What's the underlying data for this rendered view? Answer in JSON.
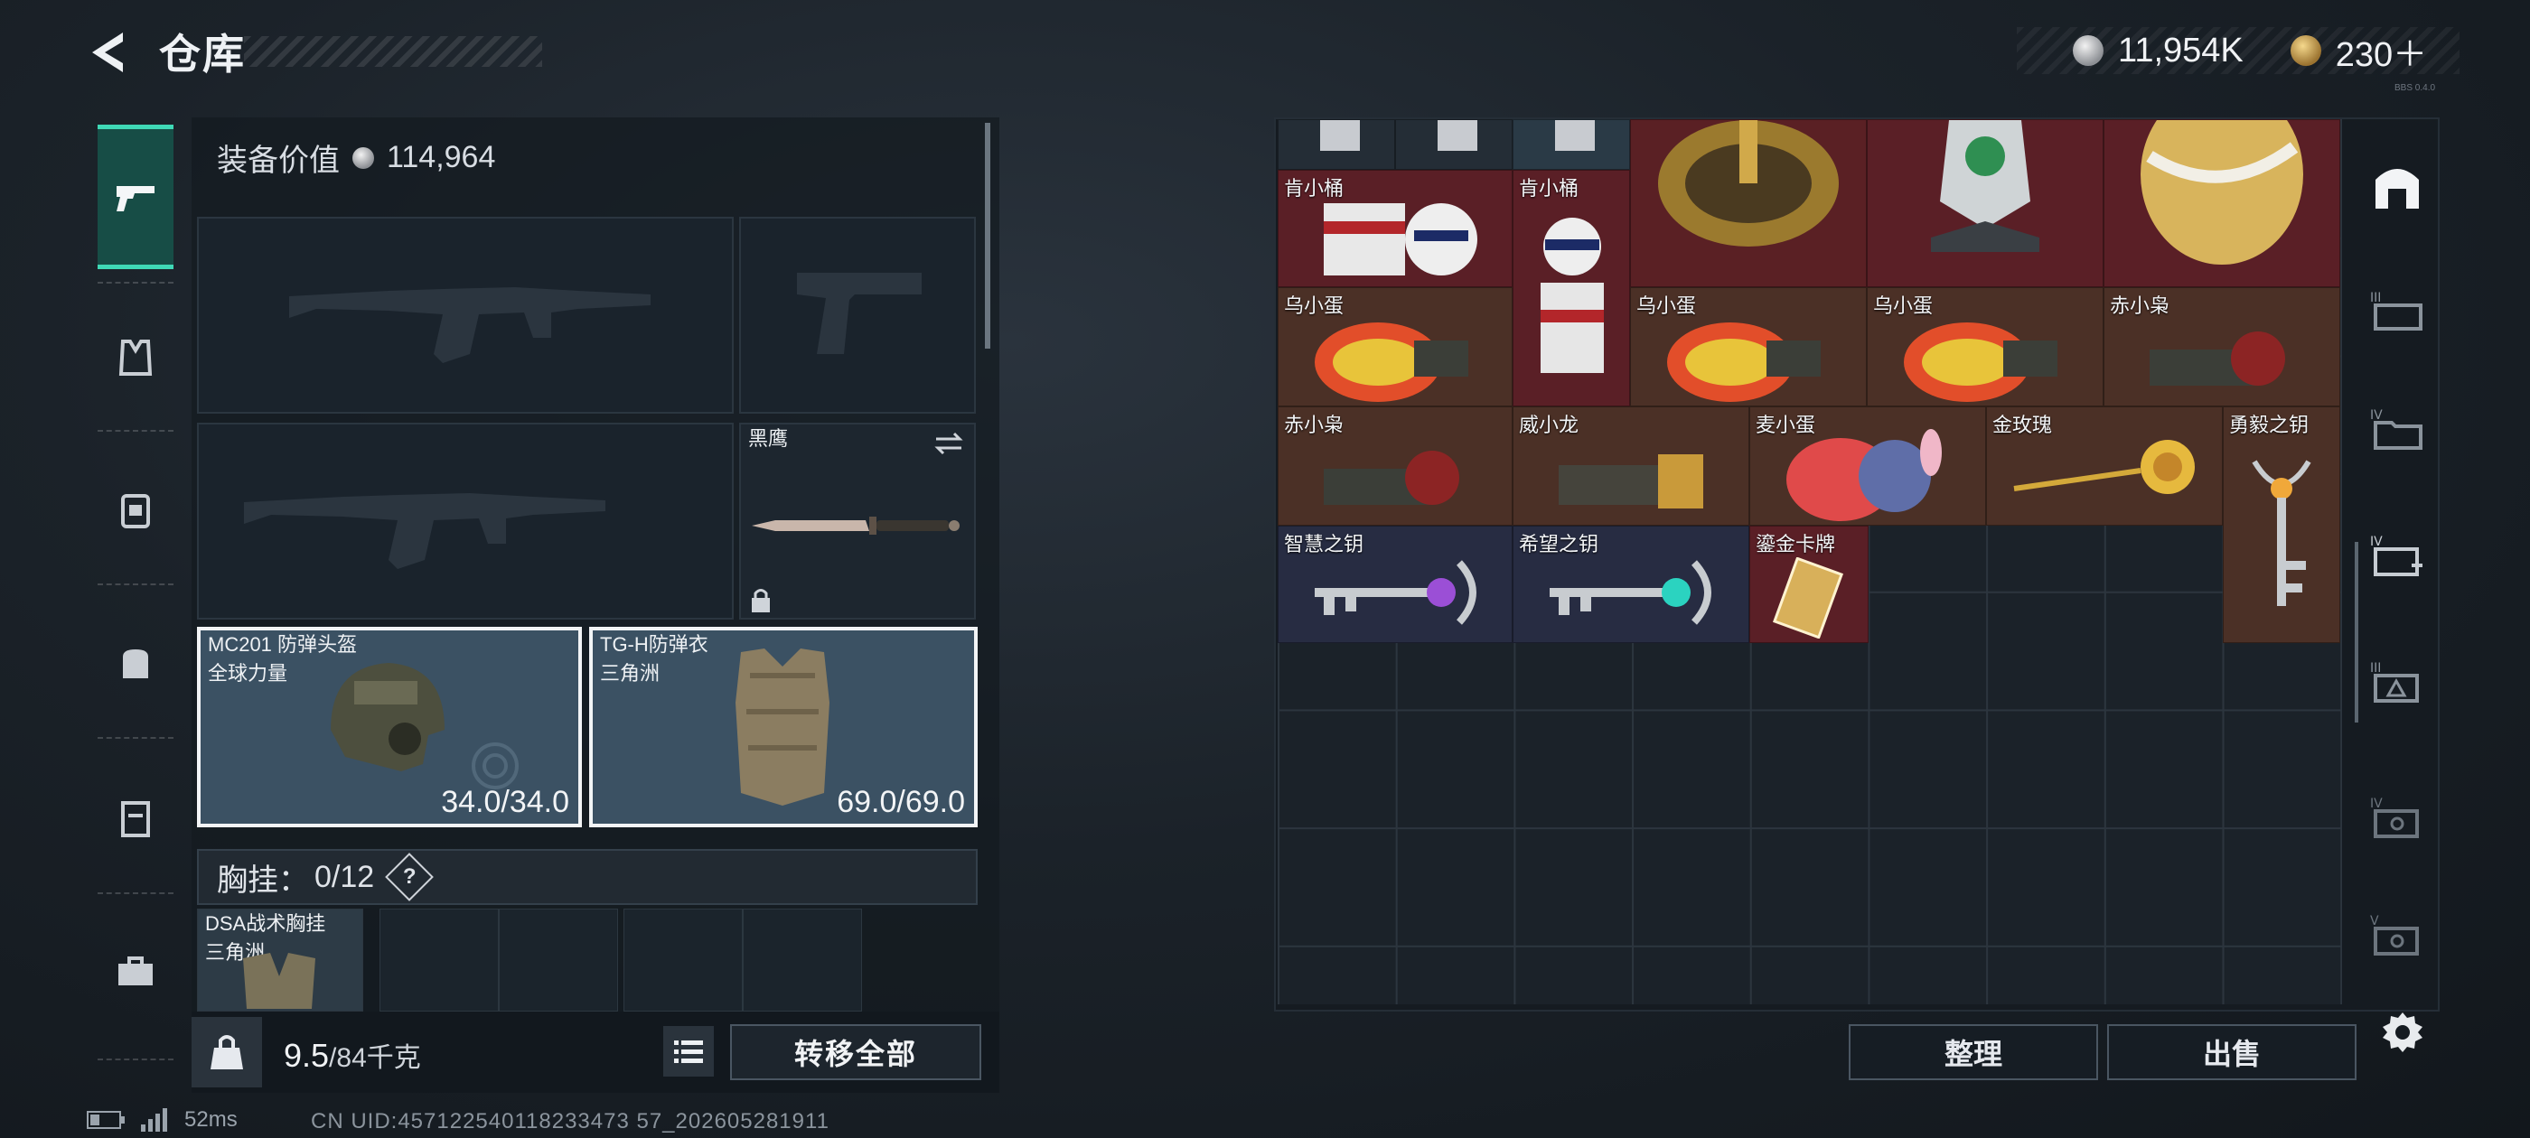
{
  "header": {
    "title": "仓库"
  },
  "currency": {
    "silver": "11,954K",
    "gold": "230＋"
  },
  "version_tag": "BBS 0.4.0",
  "left_rail": {
    "tabs": [
      "gun-icon",
      "vest-icon",
      "backpack-icon",
      "bag-icon",
      "container-icon",
      "case-icon"
    ]
  },
  "equipment": {
    "value_label": "装备价值",
    "value": "114,964",
    "knife": {
      "name": "黑鹰"
    },
    "helmet": {
      "name": "MC201 防弹头盔",
      "sub": "全球力量",
      "durability": "34.0/34.0"
    },
    "armor": {
      "name": "TG-H防弹衣",
      "sub": "三角洲",
      "durability": "69.0/69.0"
    },
    "vest_label": "胸挂：",
    "vest_count": "0/12",
    "help": "?",
    "vest_item": {
      "name": "DSA战术胸挂",
      "sub": "三角洲"
    },
    "weight": "9.5",
    "weight_max": "/84千克",
    "transfer_all": "转移全部"
  },
  "status": {
    "ping": "52ms",
    "uid": "CN UID:457122540118233473 57_202605281911"
  },
  "storage": {
    "items": [
      {
        "name": "肯小桶"
      },
      {
        "name": "肯小桶"
      },
      {
        "name": "乌小蛋"
      },
      {
        "name": "乌小蛋"
      },
      {
        "name": "乌小蛋"
      },
      {
        "name": "赤小枭"
      },
      {
        "name": "赤小枭"
      },
      {
        "name": "威小龙"
      },
      {
        "name": "麦小蛋"
      },
      {
        "name": "金玫瑰"
      },
      {
        "name": "勇毅之钥"
      },
      {
        "name": "智慧之钥"
      },
      {
        "name": "希望之钥"
      },
      {
        "name": "鎏金卡牌"
      }
    ],
    "sort": "整理",
    "sell": "出售"
  },
  "right_rail": [
    "storage-icon",
    "III-case-icon",
    "IV-folder-icon",
    "IV-medkit-icon",
    "III-tower-icon",
    "IV-safe-icon",
    "V-safe-icon"
  ],
  "colors": {
    "accent": "#3fd9b6",
    "item_red": "#5a1f26",
    "item_brown": "#4b3026",
    "item_gray": "#272c42"
  }
}
